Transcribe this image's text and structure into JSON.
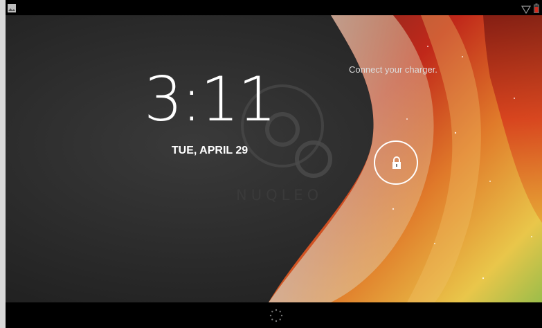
{
  "lockscreen": {
    "time": "3:11",
    "date": "TUE, APRIL 29",
    "charger_message": "Connect your charger."
  },
  "wallpaper": {
    "brand": "NUQLEO"
  },
  "icons": {
    "notification": "image-notification-icon",
    "wifi": "wifi-icon",
    "battery": "battery-low-icon",
    "lock": "lock-icon",
    "loading": "loading-spinner-icon"
  },
  "colors": {
    "background_dark": "#2b2b2b",
    "accent_red": "#c42a1a",
    "accent_orange": "#e8872a",
    "accent_yellow": "#f1d34c",
    "battery_red": "#d02a1e"
  }
}
